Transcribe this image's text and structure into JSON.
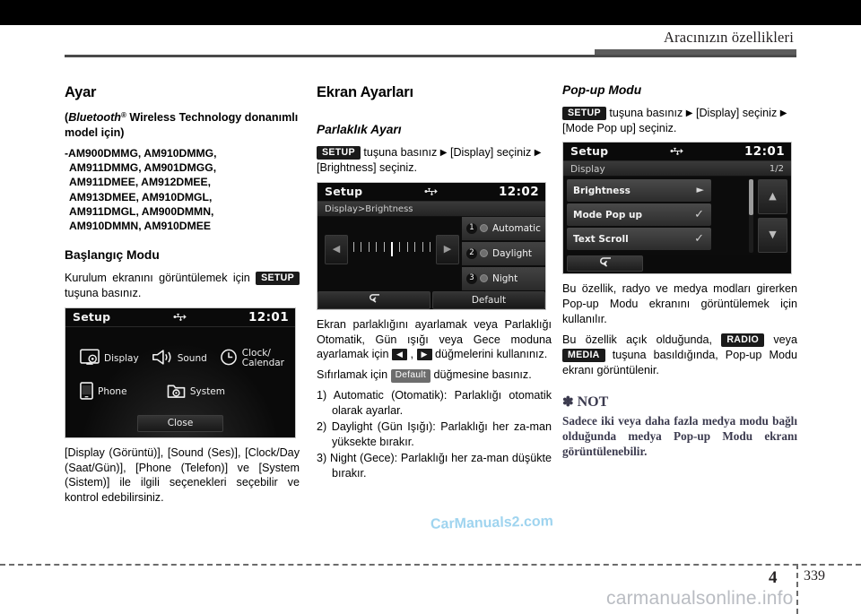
{
  "header": {
    "title": "Aracınızın özellikleri"
  },
  "footer": {
    "chapter": "4",
    "page": "339",
    "watermark_bottom": "carmanualsonline.info",
    "watermark_mid": "CarManuals2.com"
  },
  "col1": {
    "heading": "Ayar",
    "subtitle_pre": "(",
    "subtitle_bt": "Bluetooth",
    "subtitle_reg": "®",
    "subtitle_post": " Wireless Technology donanımlı model için)",
    "models": [
      "-AM900DMMG, AM910DMMG,",
      "AM911DMMG, AM901DMGG,",
      "AM911DMEE, AM912DMEE,",
      "AM913DMEE, AM910DMGL,",
      "AM911DMGL, AM900DMMN,",
      "AM910DMMN, AM910DMEE"
    ],
    "section2": "Başlangıç Modu",
    "para_pre": "Kurulum ekranını görüntülemek için ",
    "setup_key": "SETUP",
    "para_post": " tuşuna basınız.",
    "screen": {
      "title": "Setup",
      "usb_icon": "usb-icon",
      "clock": "12:01",
      "items": [
        {
          "label": "Display",
          "icon": "display-gear-icon"
        },
        {
          "label": "Sound",
          "icon": "speaker-icon"
        },
        {
          "label": "Clock/\nCalendar",
          "icon": "clock-icon"
        },
        {
          "label": "Phone",
          "icon": "phone-icon"
        },
        {
          "label": "System",
          "icon": "folder-gear-icon"
        }
      ],
      "close_label": "Close"
    },
    "para_after": "[Display (Görüntü)], [Sound (Ses)], [Clock/Day (Saat/Gün)], [Phone (Telefon)] ve [System (Sistem)] ile ilgili seçenekleri seçebilir ve kontrol edebilirsiniz."
  },
  "col2": {
    "heading": "Ekran Ayarları",
    "section": "Parlaklık Ayarı",
    "setup_key": "SETUP",
    "line_a": " tuşuna basınız ",
    "line_b": " [Display] seçiniz ",
    "line_c": " [Brightness] seçiniz.",
    "screen": {
      "title": "Setup",
      "clock": "12:02",
      "breadcrumb": "Display>Brightness",
      "options": [
        {
          "num": "1",
          "label": "Automatic"
        },
        {
          "num": "2",
          "label": "Daylight"
        },
        {
          "num": "3",
          "label": "Night"
        }
      ],
      "back_icon": "back-arrow-icon",
      "default_label": "Default"
    },
    "para1_a": "Ekran parlaklığını ayarlamak veya Parlaklığı Otomatik, Gün ışığı veya Gece moduna ayarlamak için ",
    "para1_b": " , ",
    "para1_c": " düğmelerini kullanınız.",
    "para2_a": "Sıfırlamak için ",
    "para2_key": "Default",
    "para2_b": " düğmesine basınız.",
    "numbered": [
      {
        "n": "1)",
        "text": "Automatic (Otomatik): Parlaklığı otomatik olarak ayarlar."
      },
      {
        "n": "2)",
        "text": "Daylight (Gün Işığı): Parlaklığı her za-man yüksekte bırakır."
      },
      {
        "n": "3)",
        "text": "Night (Gece): Parlaklığı her za-man düşükte bırakır."
      }
    ]
  },
  "col3": {
    "section": "Pop-up Modu",
    "setup_key": "SETUP",
    "line_a": " tuşuna basınız ",
    "line_b": " [Display] seçiniz ",
    "line_c": " [Mode Pop up] seçiniz.",
    "screen": {
      "title": "Setup",
      "clock": "12:01",
      "list_header": "Display",
      "page_indicator": "1/2",
      "rows": [
        {
          "label": "Brightness",
          "mark": "►"
        },
        {
          "label": "Mode Pop up",
          "mark": "✓"
        },
        {
          "label": "Text Scroll",
          "mark": "✓"
        }
      ],
      "up_icon": "up-arrow-icon",
      "down_icon": "down-arrow-icon",
      "back_icon": "back-arrow-icon"
    },
    "para1": "Bu özellik, radyo ve medya modları girerken Pop-up Modu ekranını görüntülemek için kullanılır.",
    "para2_a": "Bu özellik açık olduğunda, ",
    "radio_key": "RADIO",
    "para2_b": " veya ",
    "media_key": "MEDIA",
    "para2_c": " tuşuna basıldığında, Pop-up Modu ekranı görüntülenir.",
    "note_title": "NOT",
    "note_text": "Sadece iki veya daha fazla medya modu bağlı olduğunda medya Pop-up Modu ekranı görüntülenebilir."
  }
}
